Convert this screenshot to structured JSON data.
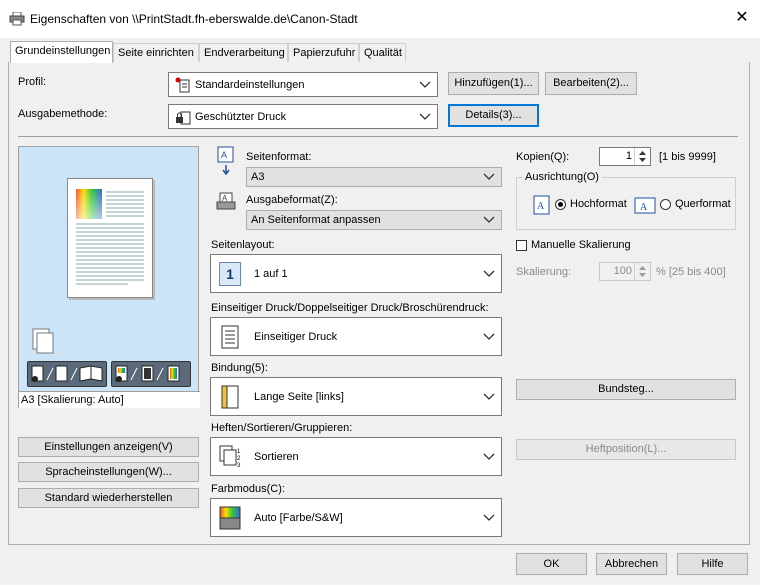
{
  "window": {
    "title": "Eigenschaften von \\\\PrintStadt.fh-eberswalde.de\\Canon-Stadt",
    "close_icon": "close-icon",
    "app_icon": "printer-icon"
  },
  "tabs": [
    {
      "label": "Grundeinstellungen",
      "active": true
    },
    {
      "label": "Seite einrichten"
    },
    {
      "label": "Endverarbeitung"
    },
    {
      "label": "Papierzufuhr"
    },
    {
      "label": "Qualität"
    }
  ],
  "profile": {
    "label": "Profil:",
    "value": "Standardeinstellungen",
    "add_button": "Hinzufügen(1)...",
    "edit_button": "Bearbeiten(2)..."
  },
  "output_method": {
    "label": "Ausgabemethode:",
    "value": "Geschützter Druck",
    "details_button": "Details(3)..."
  },
  "preview": {
    "status": "A3 [Skalierung: Auto]"
  },
  "left_buttons": {
    "show_settings": "Einstellungen anzeigen(V)",
    "language_settings": "Spracheinstellungen(W)...",
    "restore_defaults": "Standard wiederherstellen"
  },
  "page_size": {
    "label": "Seitenformat:",
    "value": "A3"
  },
  "output_size": {
    "label": "Ausgabeformat(Z):",
    "value": "An Seitenformat anpassen"
  },
  "page_layout": {
    "label": "Seitenlayout:",
    "value": "1 auf 1",
    "icon_number": "1"
  },
  "print_style": {
    "label": "Einseitiger Druck/Doppelseitiger Druck/Broschürendruck:",
    "value": "Einseitiger Druck"
  },
  "binding": {
    "label": "Bindung(5):",
    "value": "Lange Seite [links]"
  },
  "finishing": {
    "label": "Heften/Sortieren/Gruppieren:",
    "value": "Sortieren"
  },
  "color_mode": {
    "label": "Farbmodus(C):",
    "value": "Auto [Farbe/S&W]"
  },
  "copies": {
    "label": "Kopien(Q):",
    "value": "1",
    "range": "[1 bis 9999]"
  },
  "orientation": {
    "legend": "Ausrichtung(O)",
    "portrait": "Hochformat",
    "landscape": "Querformat",
    "selected": "portrait"
  },
  "manual_scaling": {
    "label": "Manuelle Skalierung",
    "checked": false
  },
  "scaling": {
    "label": "Skalierung:",
    "value": "100",
    "range": "% [25 bis 400]"
  },
  "gutter_button": "Bundsteg...",
  "staple_position_button": "Heftposition(L)...",
  "footer": {
    "ok": "OK",
    "cancel": "Abbrechen",
    "help": "Hilfe"
  }
}
